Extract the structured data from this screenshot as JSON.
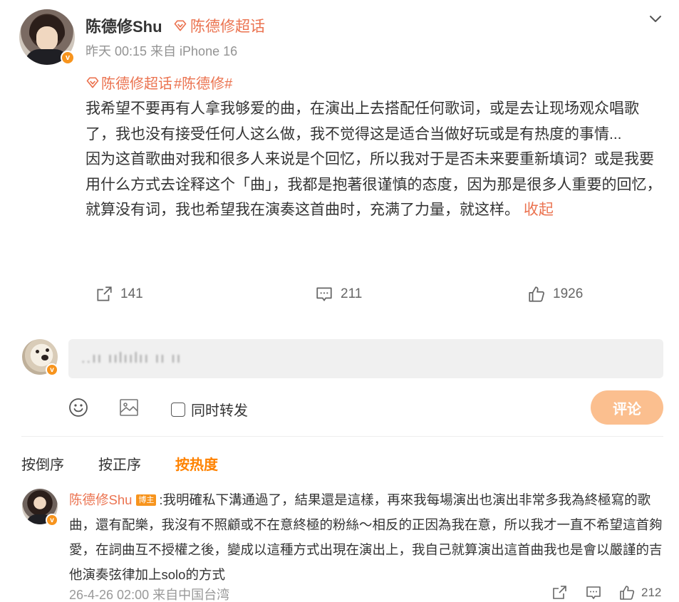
{
  "post": {
    "author": "陈德修Shu",
    "supertopic_label": "陈德修超话",
    "meta": "昨天 00:15  来自 iPhone 16",
    "tag_supertopic": "陈德修超话",
    "tag_hashtag": "#陈德修#",
    "paragraph1": "我希望不要再有人拿我够爱的曲，在演出上去搭配任何歌词，或是去让现场观众唱歌了，我也没有接受任何人这么做，我不觉得这是适合当做好玩或是有热度的事情...",
    "paragraph2": "因为这首歌曲对我和很多人来说是个回忆，所以我对于是否未来要重新填词？或是我要用什么方式去诠释这个「曲」，我都是抱著很谨慎的态度，因为那是很多人重要的回忆，就算没有词，我也希望我在演奏这首曲时，充满了力量，就这样。",
    "collapse_label": "收起",
    "repost_count": "141",
    "comment_count": "211",
    "like_count": "1926"
  },
  "composer": {
    "input_text": "..ıı ıılıılıı ıı ıı",
    "repost_checkbox_label": "同时转发",
    "submit_label": "评论"
  },
  "sort": {
    "reverse": "按倒序",
    "forward": "按正序",
    "hot": "按热度"
  },
  "comment": {
    "author": "陈德修Shu",
    "badge": "博主",
    "text": ":我明確私下溝通過了，結果還是這樣，再來我每場演出也演出非常多我為終極寫的歌曲，還有配樂，我沒有不照顧或不在意終極的粉絲～相反的正因為我在意，所以我才一直不希望這首夠愛，在詞曲互不授權之後，變成以這種方式出現在演出上，我自己就算演出這首曲我也是會以嚴謹的吉他演奏弦律加上solo的方式",
    "meta": "26-4-26 02:00  来自中国台湾",
    "like_count": "212"
  },
  "colors": {
    "accent": "#eb7350",
    "orange": "#ff8200",
    "badge": "#f7941d",
    "submit_bg": "#fbbf8f"
  },
  "icons": [
    "chevron-down-icon",
    "gem-icon",
    "repost-icon",
    "comment-icon",
    "like-icon",
    "emoji-icon",
    "image-icon",
    "verified-icon"
  ]
}
